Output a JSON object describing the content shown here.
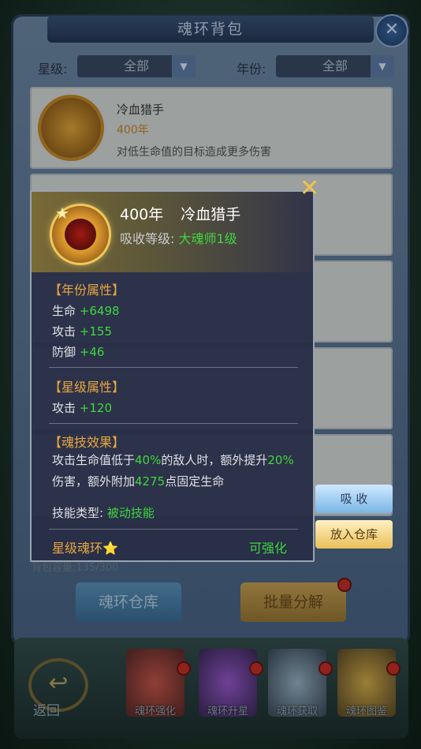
{
  "background": {
    "title": "魂环背包",
    "filter_star_label": "星级:",
    "filter_star_value": "全部",
    "filter_year_label": "年份:",
    "filter_year_value": "全部",
    "first_item": {
      "name": "冷血猎手",
      "year": "400年",
      "desc": "对低生命值的目标造成更多伤害"
    },
    "capacity": "背包容量:135/300",
    "ring_storage_button": "魂环仓库",
    "batch_decompose_button": "批量分解",
    "back_label": "返回",
    "nav": [
      "魂环强化",
      "魂环升星",
      "魂环获取",
      "魂环图鉴"
    ]
  },
  "popup": {
    "year": "400年",
    "name": "冷血猎手",
    "absorb_label": "吸收等级:",
    "absorb_value": "大魂师1级",
    "year_attr_title": "【年份属性】",
    "year_attrs": [
      {
        "label": "生命",
        "value": "+6498"
      },
      {
        "label": "攻击",
        "value": "+155"
      },
      {
        "label": "防御",
        "value": "+46"
      }
    ],
    "star_attr_title": "【星级属性】",
    "star_attrs": [
      {
        "label": "攻击",
        "value": "+120"
      }
    ],
    "skill_title": "【魂技效果】",
    "skill_desc": {
      "p1": "攻击生命值低于",
      "v1": "40%",
      "p2": "的敌人时，额外提升",
      "v2": "20%",
      "p3": "伤害，额外附加",
      "v3": "4275",
      "p4": "点固定生命"
    },
    "skill_type_label": "技能类型:",
    "skill_type_value": "被动技能",
    "star_ring_label": "星级魂环",
    "star_glyph": "⭐",
    "enhance_label": "可强化"
  },
  "actions": {
    "absorb": "吸 收",
    "store": "放入仓库"
  },
  "colors": {
    "accent_gold": "#e8a640",
    "value_green": "#3fd63f",
    "popup_bg": "#282e46"
  }
}
